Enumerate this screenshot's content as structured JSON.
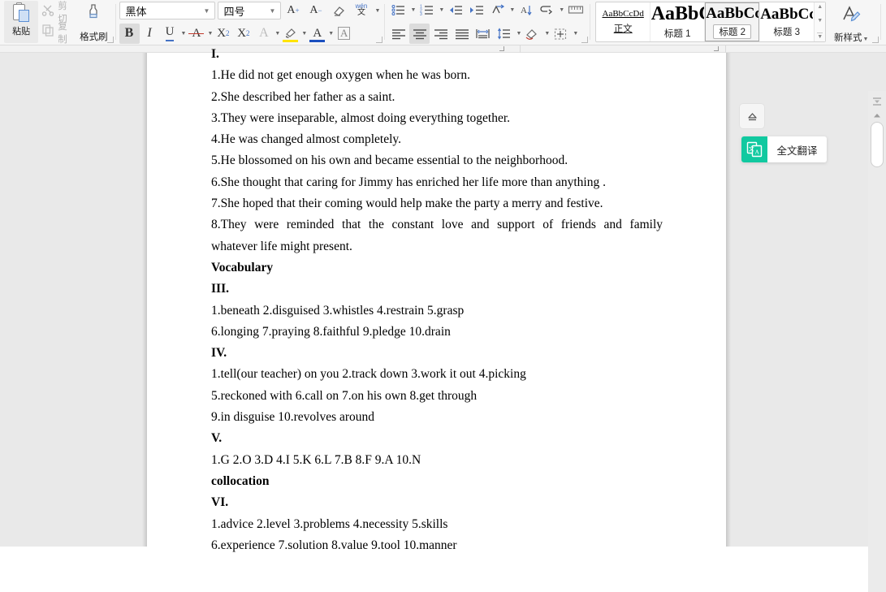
{
  "ribbon": {
    "clipboard": {
      "paste_label": "粘贴",
      "cut_label": "剪切",
      "copy_label": "复制",
      "format_painter_label": "格式刷"
    },
    "font": {
      "font_name": "黑体",
      "font_size": "四号",
      "bold_label": "B",
      "italic_label": "I",
      "underline_label": "U",
      "strikethrough_label": "A",
      "superscript_label": "X",
      "superscript_sup": "2",
      "subscript_label": "X",
      "subscript_sub": "2",
      "text_effect_label": "A",
      "highlight_label": "A",
      "font_color_label": "A",
      "char_border_label": "A",
      "grow_font_label": "A",
      "grow_font_sup": "+",
      "shrink_font_label": "A",
      "shrink_font_sup": "−",
      "pinyin_top": "wén",
      "pinyin_bottom": "文"
    },
    "paragraph": {
      "bullets": "•",
      "numbering": "1",
      "decrease_indent": "←",
      "increase_indent": "→",
      "sort": "A",
      "show_marks": "¶",
      "align_left": "≡",
      "align_center": "≡",
      "align_right": "≡",
      "justify": "≡",
      "distribute": "≡",
      "line_spacing": "↕",
      "shading": "◇",
      "borders": "⊞"
    },
    "styles": {
      "items": [
        {
          "preview": "AaBbCcDd",
          "preview_size": "11px",
          "name": "正文",
          "selected": false,
          "underline": true
        },
        {
          "preview": "AaBbCc",
          "preview_size": "24px",
          "name": "标题 1",
          "selected": false,
          "underline": false
        },
        {
          "preview": "AaBbCc",
          "preview_size": "19px",
          "name": "标题 2",
          "selected": true,
          "underline": false
        },
        {
          "preview": "AaBbCc",
          "preview_size": "19px",
          "name": "标题 3",
          "selected": false,
          "underline": false
        }
      ],
      "scroll_up": "▲",
      "scroll_down": "▼",
      "scroll_more": "▼",
      "new_style_label": "新样式"
    },
    "accent_color": "#4472c4",
    "highlight_color": "#ffe400",
    "font_color_bar": "#1a4fbf",
    "strikethrough_color": "#c0392b"
  },
  "document": {
    "lines": [
      {
        "text": "I.",
        "bold": true,
        "mode": "clip"
      },
      {
        "text": "1.He did not get enough oxygen when he was born.",
        "bold": false
      },
      {
        "text": "2.She described her father as a saint.",
        "bold": false
      },
      {
        "text": "3.They were inseparable, almost doing everything together.",
        "bold": false
      },
      {
        "text": "4.He was changed almost completely.",
        "bold": false
      },
      {
        "text": "5.He blossomed on his own and became essential to the neighborhood.",
        "bold": false
      },
      {
        "text": "6.She thought that caring for Jimmy has enriched her life more than anything .",
        "bold": false
      },
      {
        "text": "7.She hoped that their coming would help make the party a merry and festive.",
        "bold": false
      },
      {
        "text": "8.They were reminded that the constant love and support of friends and family",
        "bold": false,
        "mode": "justify"
      },
      {
        "text": "whatever life might present.",
        "bold": false
      },
      {
        "text": "Vocabulary",
        "bold": true
      },
      {
        "text": "III.",
        "bold": true
      },
      {
        "text": "1.beneath    2.disguised    3.whistles    4.restrain    5.grasp",
        "bold": false
      },
      {
        "text": "6.longing    7.praying    8.faithful    9.pledge    10.drain",
        "bold": false
      },
      {
        "text": "IV.",
        "bold": true
      },
      {
        "text": "1.tell(our teacher) on you    2.track down    3.work it out   4.picking",
        "bold": false
      },
      {
        "text": "5.reckoned with    6.call on    7.on his own    8.get through",
        "bold": false
      },
      {
        "text": "9.in disguise    10.revolves around",
        "bold": false
      },
      {
        "text": "V.",
        "bold": true
      },
      {
        "text": "1.G    2.O    3.D    4.I    5.K    6.L    7.B    8.F    9.A    10.N",
        "bold": false
      },
      {
        "text": "collocation",
        "bold": true
      },
      {
        "text": "VI.",
        "bold": true
      },
      {
        "text": "1.advice    2.level    3.problems    4.necessity    5.skills",
        "bold": false
      },
      {
        "text": "6.experience    7.solution    8.value    9.tool    10.manner",
        "bold": false
      }
    ]
  },
  "right_panel": {
    "collapse_icon": "eject-icon",
    "translate_label": "全文翻译",
    "translate_icon_color": "#11c9a0",
    "translate_icon_glyph": "文A"
  },
  "scrollbar": {
    "up_arrow": "▲",
    "top_icon": "split-view-icon"
  }
}
